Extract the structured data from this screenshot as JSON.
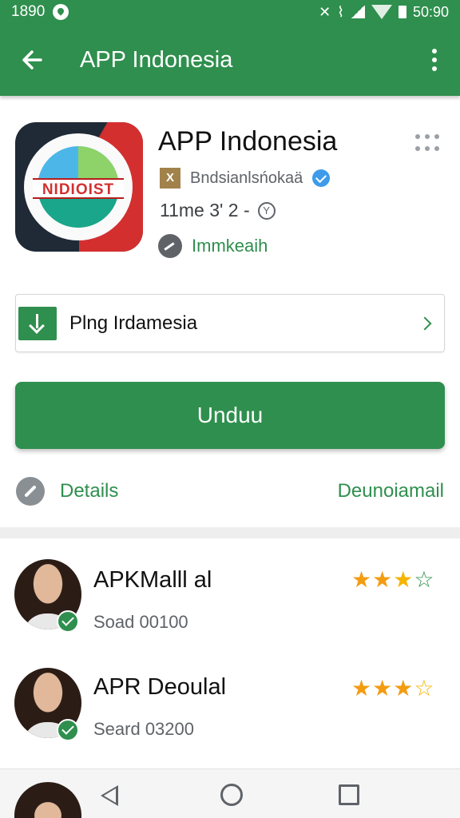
{
  "status_bar": {
    "time": "1890",
    "right_text": "50:90",
    "icons": [
      "notification-dot-icon",
      "nfc-icon",
      "vibrate-icon",
      "signal-icon",
      "wifi-icon",
      "battery-icon"
    ]
  },
  "app_bar": {
    "title": "APP Indonesia",
    "back_icon": "arrow-left-icon",
    "menu_icon": "more-vert-icon",
    "color": "#2f8f4e"
  },
  "app": {
    "name": "APP Indonesia",
    "icon_text": "NIDIOIST",
    "developer": "Bndsianlsńokaä",
    "developer_icon_text": "X",
    "meta": "11me 3' 2 -",
    "status": "Immkeaih"
  },
  "link_card": {
    "label": "Plng Irdamesia"
  },
  "primary_button": {
    "label": "Unduu"
  },
  "details_row": {
    "details_label": "Details",
    "secondary_label": "Deunoiamail"
  },
  "reviews": [
    {
      "name": "APKMalll al",
      "meta": "Soad 00100",
      "rating": 3.5
    },
    {
      "name": "APR Deoulal",
      "meta": "Seard 03200",
      "rating": 3.5
    }
  ],
  "colors": {
    "accent": "#2f8f4e",
    "star": "#f39c12"
  }
}
